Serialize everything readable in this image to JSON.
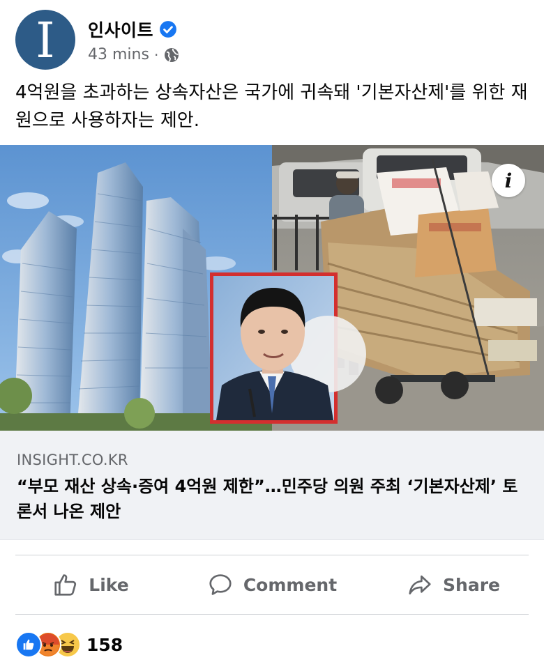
{
  "post": {
    "page_name": "인사이트",
    "avatar_letter": "I",
    "time": "43 mins",
    "separator": "·",
    "text": "4억원을 초과하는 상속자산은 국가에 귀속돼 '기본자산제'를 위한 재원으로 사용하자는 제안."
  },
  "link_preview": {
    "domain": "INSIGHT.CO.KR",
    "title": "“부모 재산 상속·증여 4억원 제한”…민주당 의원 주최 ‘기본자산제’ 토론서 나온 제안"
  },
  "media": {
    "info_glyph": "i"
  },
  "actions": {
    "like": "Like",
    "comment": "Comment",
    "share": "Share"
  },
  "reactions": {
    "count": "158",
    "icons": [
      "like-icon",
      "angry-icon",
      "haha-icon"
    ]
  },
  "colors": {
    "avatar": "#2d5b87",
    "verified": "#1877f2",
    "secondary_text": "#65676b",
    "preview_bg": "#f0f2f5",
    "inset_border": "#d32f2f"
  }
}
